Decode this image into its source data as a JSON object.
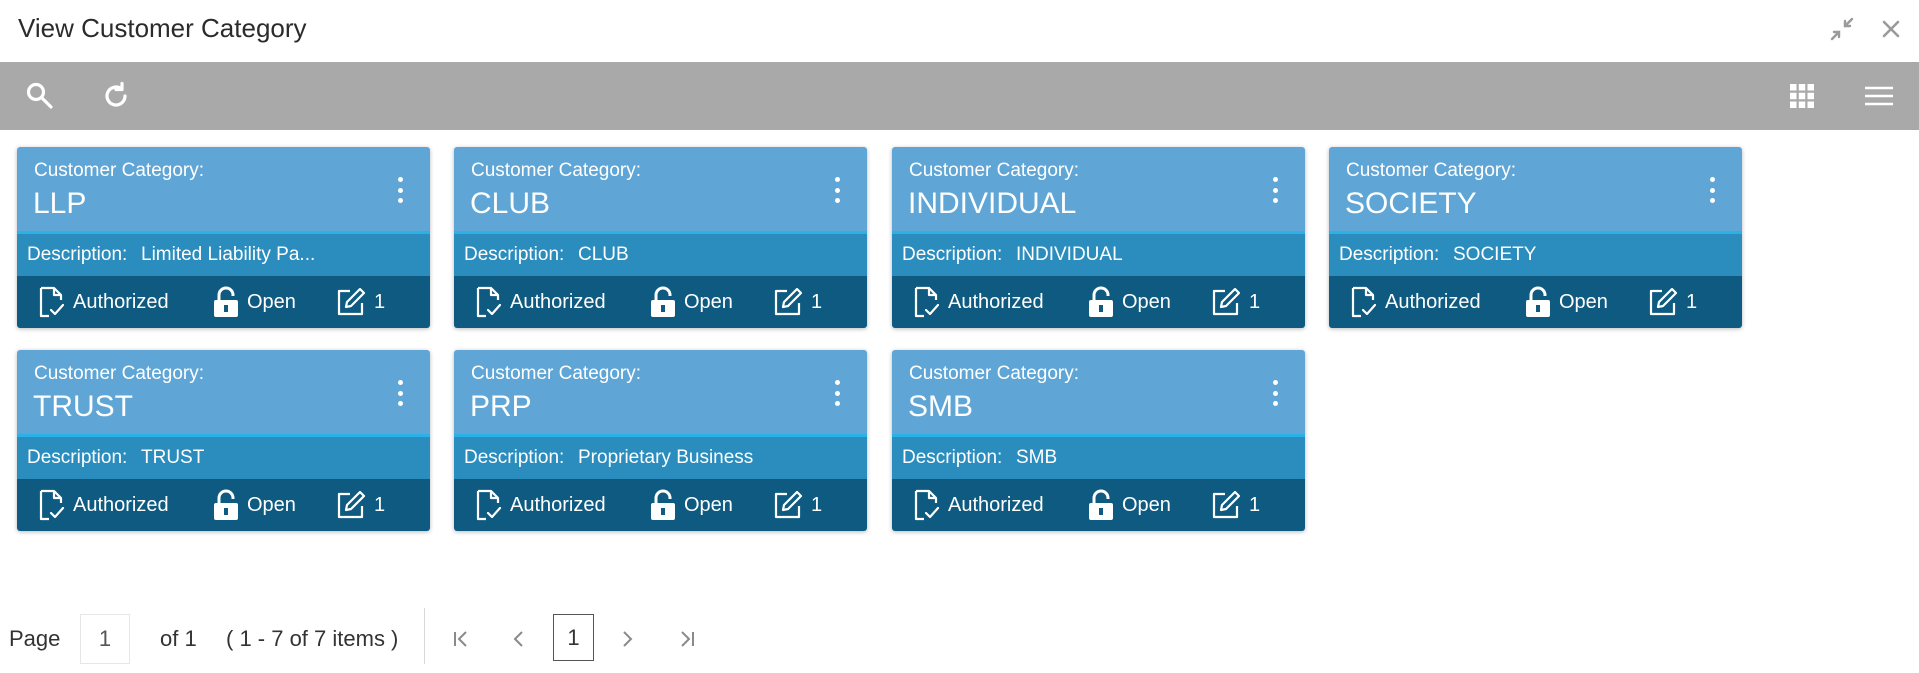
{
  "window": {
    "title": "View Customer Category"
  },
  "toolbar": {},
  "colors": {
    "card_top": "#5fa6d6",
    "card_desc": "#2a8dbe",
    "card_footer": "#0e5a80",
    "accent_line": "#29b1e8",
    "toolbar_bg": "#a9a9a9"
  },
  "cards": [
    {
      "label": "Customer Category:",
      "name": "LLP",
      "desc_label": "Description:",
      "desc_value": "Limited Liability Pa...",
      "auth": "Authorized",
      "lock": "Open",
      "version": "1"
    },
    {
      "label": "Customer Category:",
      "name": "CLUB",
      "desc_label": "Description:",
      "desc_value": "CLUB",
      "auth": "Authorized",
      "lock": "Open",
      "version": "1"
    },
    {
      "label": "Customer Category:",
      "name": "INDIVIDUAL",
      "desc_label": "Description:",
      "desc_value": "INDIVIDUAL",
      "auth": "Authorized",
      "lock": "Open",
      "version": "1"
    },
    {
      "label": "Customer Category:",
      "name": "SOCIETY",
      "desc_label": "Description:",
      "desc_value": "SOCIETY",
      "auth": "Authorized",
      "lock": "Open",
      "version": "1"
    },
    {
      "label": "Customer Category:",
      "name": "TRUST",
      "desc_label": "Description:",
      "desc_value": "TRUST",
      "auth": "Authorized",
      "lock": "Open",
      "version": "1"
    },
    {
      "label": "Customer Category:",
      "name": "PRP",
      "desc_label": "Description:",
      "desc_value": "Proprietary Business",
      "auth": "Authorized",
      "lock": "Open",
      "version": "1"
    },
    {
      "label": "Customer Category:",
      "name": "SMB",
      "desc_label": "Description:",
      "desc_value": "SMB",
      "auth": "Authorized",
      "lock": "Open",
      "version": "1"
    }
  ],
  "pagination": {
    "page_label": "Page",
    "page_input": "1",
    "of_label": "of 1",
    "items_summary": "( 1 - 7 of 7 items )",
    "current_page": "1"
  }
}
